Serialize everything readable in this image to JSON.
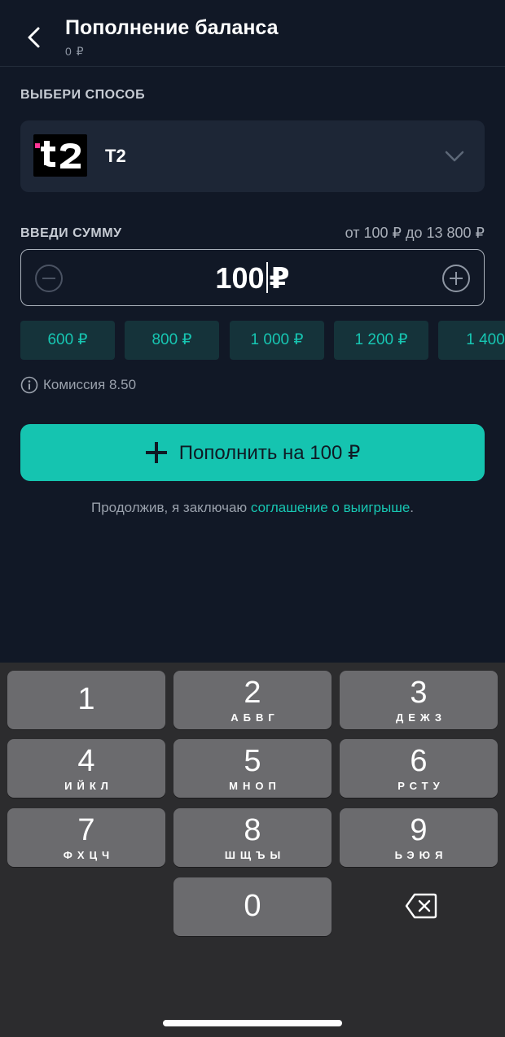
{
  "header": {
    "title": "Пополнение баланса",
    "balance": "0 ₽"
  },
  "method": {
    "section_label": "ВЫБЕРИ СПОСОБ",
    "selected_name": "T2",
    "logo_icon": "t2-logo-icon"
  },
  "amount": {
    "section_label": "ВВЕДИ СУММУ",
    "range": "от 100 ₽ до 13 800 ₽",
    "value": "100",
    "currency": "₽"
  },
  "presets": [
    "600 ₽",
    "800 ₽",
    "1 000 ₽",
    "1 200 ₽",
    "1 400"
  ],
  "commission": "Комиссия 8.50",
  "submit_label": "Пополнить на 100 ₽",
  "agreement": {
    "prefix": "Продолжив, я заключаю ",
    "link": "соглашение о выигрыше",
    "suffix": "."
  },
  "keyboard": {
    "keys": [
      {
        "digit": "1",
        "letters": ""
      },
      {
        "digit": "2",
        "letters": "АБВГ"
      },
      {
        "digit": "3",
        "letters": "ДЕЖЗ"
      },
      {
        "digit": "4",
        "letters": "ИЙКЛ"
      },
      {
        "digit": "5",
        "letters": "МНОП"
      },
      {
        "digit": "6",
        "letters": "РСТУ"
      },
      {
        "digit": "7",
        "letters": "ФХЦЧ"
      },
      {
        "digit": "8",
        "letters": "ШЩЪЫ"
      },
      {
        "digit": "9",
        "letters": "ЬЭЮЯ"
      },
      {
        "digit": "0",
        "letters": ""
      }
    ]
  },
  "colors": {
    "background": "#111826",
    "accent": "#15c4b0",
    "card": "#1d2636",
    "chip": "#15333a"
  }
}
